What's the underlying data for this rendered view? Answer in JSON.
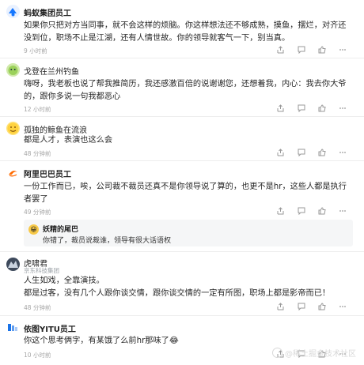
{
  "comments": [
    {
      "name": "蚂蚁集团员工",
      "text": "如果你只把对方当同事，就不会这样的烦脑。你这样想法还不够成熟，摸鱼，摆烂，对齐还没到位，职场不止是江湖，还有人情世故。你的领导就客气一下，别当真。",
      "time": "9 小时前"
    },
    {
      "name": "戈登在兰州钓鱼",
      "text": "嗨呀，我老板也说了帮我推简历，我还感激百倍的说谢谢您，还想着我，内心：我去你大爷的，跟你多说一句我都恶心",
      "time": "12 小时前"
    },
    {
      "name": "孤独的鲸鱼在流浪",
      "text": "都是人才，表演也这么会",
      "time": "48 分钟前"
    },
    {
      "name": "阿里巴巴员工",
      "text": "一份工作而已，唉，公司裁不裁员还真不是你领导说了算的，也更不是hr，这些人都是执行者罢了",
      "time": "49 分钟前",
      "reply": {
        "name": "妖精的尾巴",
        "text": "你错了，裁员说裁谁，领导有很大话语权"
      }
    },
    {
      "name": "虎啸君",
      "subtitle": "京东科技集团",
      "text": "人生如戏，全靠演技。\n都是过客，没有几个人跟你谈交情，跟你谈交情的一定有所图，职场上都是影帝而已！",
      "time": "48 分钟前"
    },
    {
      "name": "依图YITU员工",
      "text": "你这个思考俩字，有某饿了么前hr那味了😂",
      "time": "10 小时前"
    }
  ],
  "icons": [
    "share-icon",
    "comment-icon",
    "like-icon",
    "more-icon"
  ],
  "watermark": "@稀土掘金技术社区"
}
